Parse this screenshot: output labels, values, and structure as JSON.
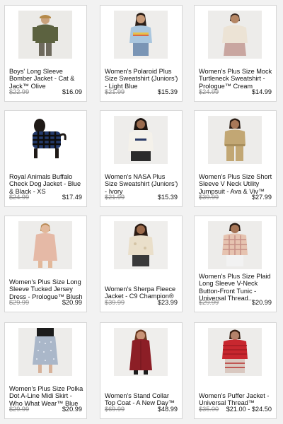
{
  "products": [
    {
      "title": "Boys' Long Sleeve Bomber Jacket - Cat & Jack™ Olive",
      "regular_price": "$22.99",
      "sale_price": "$16.09",
      "image": "olive-bomber-jacket-boy"
    },
    {
      "title": "Women's Polaroid Plus Size Sweatshirt (Juniors') - Light Blue",
      "regular_price": "$21.99",
      "sale_price": "$15.39",
      "image": "light-blue-sweatshirt-woman"
    },
    {
      "title": "Women's Plus Size Mock Turtleneck Sweatshirt - Prologue™ Cream",
      "regular_price": "$24.99",
      "sale_price": "$14.99",
      "image": "cream-turtleneck-woman"
    },
    {
      "title": "Royal Animals Buffalo Check Dog Jacket - Blue & Black - XS",
      "regular_price": "$24.99",
      "sale_price": "$17.49",
      "image": "dog-in-plaid-jacket"
    },
    {
      "title": "Women's NASA Plus Size Sweatshirt (Juniors') - Ivory",
      "regular_price": "$21.99",
      "sale_price": "$15.39",
      "image": "ivory-sweatshirt-woman"
    },
    {
      "title": "Women's Plus Size Short Sleeve V Neck Utility Jumpsuit - Ava & Viv™ Tan",
      "regular_price": "$39.99",
      "sale_price": "$27.99",
      "image": "tan-jumpsuit-woman"
    },
    {
      "title": "Women's Plus Size Long Sleeve Tucked Jersey Dress - Prologue™ Blush",
      "regular_price": "$29.99",
      "sale_price": "$20.99",
      "image": "blush-dress-woman"
    },
    {
      "title": "Women's Sherpa Fleece Jacket - C9 Champion®",
      "regular_price": "$39.99",
      "sale_price": "$23.99",
      "image": "sherpa-jacket-woman"
    },
    {
      "title": "Women's Plus Size Plaid Long Sleeve V-Neck Button-Front Tunic - Universal Thread...",
      "regular_price": "$29.99",
      "sale_price": "$20.99",
      "image": "plaid-tunic-woman"
    },
    {
      "title": "Women's Plus Size Polka Dot A-Line Midi Skirt - Who What Wear™ Blue",
      "regular_price": "$29.99",
      "sale_price": "$20.99",
      "image": "polka-dot-skirt"
    },
    {
      "title": "Women's Stand Collar Top Coat - A New Day™",
      "regular_price": "$69.99",
      "sale_price": "$48.99",
      "image": "red-top-coat-woman"
    },
    {
      "title": "Women's Puffer Jacket - Universal Thread™",
      "regular_price": "$35.00",
      "sale_price": "$21.00 - $24.50",
      "image": "red-puffer-jacket-woman"
    }
  ]
}
